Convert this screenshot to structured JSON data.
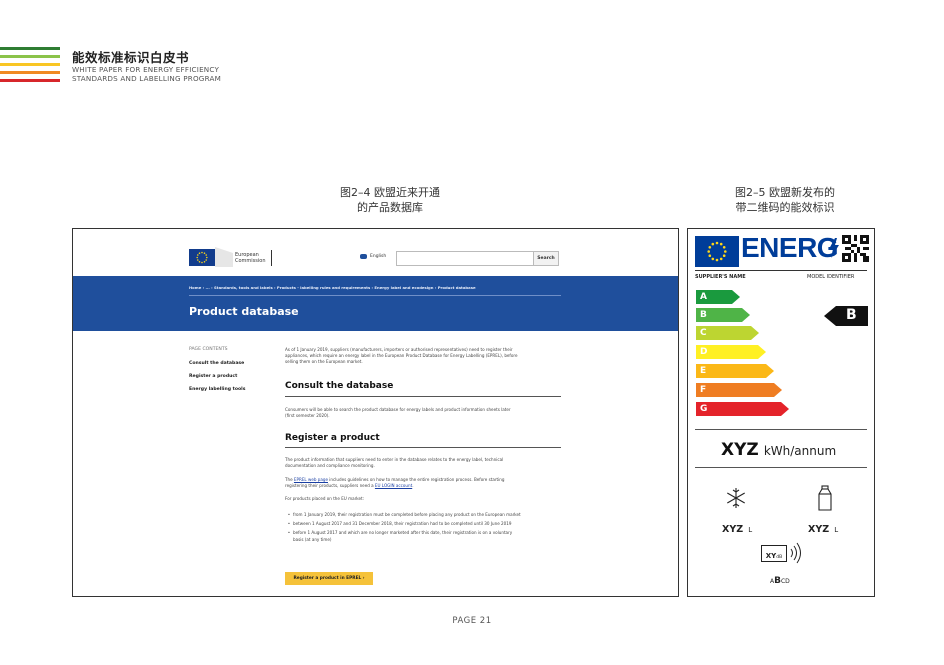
{
  "header": {
    "title_zh": "能效标准标识白皮书",
    "title_en_line1": "WHITE PAPER FOR ENERGY EFFICIENCY",
    "title_en_line2": "STANDARDS AND LABELLING PROGRAM",
    "stripe_colors": [
      "#2e7d32",
      "#8bc34a",
      "#f9c623",
      "#f08a24",
      "#d7262b"
    ]
  },
  "figures": {
    "fig1_caption_line1": "图2–4  欧盟近来开通",
    "fig1_caption_line2": "的产品数据库",
    "fig2_caption_line1": "图2–5  欧盟新发布的",
    "fig2_caption_line2": "带二维码的能效标识"
  },
  "eu_site": {
    "logo_line1": "European",
    "logo_line2": "Commission",
    "language": "English",
    "search_button": "Search",
    "breadcrumb": "Home  ›  ...  ›  Standards, tools and labels  ›  Products - labelling rules and requirements  ›  Energy label and ecodesign  ›  Product database",
    "page_title": "Product database",
    "sidebar": {
      "heading": "PAGE CONTENTS",
      "items": [
        "Consult the database",
        "Register a product",
        "Energy labelling tools"
      ]
    },
    "intro": "As of 1 January 2019, suppliers (manufacturers, importers or authorised representatives) need to register their appliances, which require an energy label in the European Product Database for Energy Labelling (EPREL), before selling them on the European market.",
    "section1_title": "Consult the database",
    "section1_text": "Consumers will be able to search the product database for energy labels and product information sheets later (first semester 2020).",
    "section2_title": "Register a product",
    "section2_p1": "The product information that suppliers need to enter in the database relates to the energy label, technical documentation and compliance monitoring.",
    "section2_p2_pre": "The ",
    "section2_p2_link1": "EPREL web page",
    "section2_p2_mid": " includes guidelines on how to manage the entire registration process. Before starting registering their products, suppliers need a ",
    "section2_p2_link2": "EU LOGIN account",
    "section2_p2_post": ".",
    "section2_p3": "For products placed on the EU market:",
    "bullets": [
      "from 1 January 2019, their registration must be completed before placing any product on the European market",
      "between 1 August 2017 and 31 December 2018, their registration had to be completed until 30 June 2019",
      "before 1 August 2017 and which are no longer marketed after this date, their registration is on a voluntary basis (at any time)"
    ],
    "cta_button": "Register a product in EPREL  ›"
  },
  "energy_label": {
    "brand": "ENERG",
    "supplier": "SUPPLIER'S NAME",
    "model": "MODEL IDENTIFIER",
    "classes": [
      {
        "letter": "A",
        "color": "#1a9a3e"
      },
      {
        "letter": "B",
        "color": "#4fb447"
      },
      {
        "letter": "C",
        "color": "#bdd531"
      },
      {
        "letter": "D",
        "color": "#fff023"
      },
      {
        "letter": "E",
        "color": "#fbb817"
      },
      {
        "letter": "F",
        "color": "#ef7d22"
      },
      {
        "letter": "G",
        "color": "#e4232a"
      }
    ],
    "rating": "B",
    "consumption_value": "XYZ",
    "consumption_unit": "kWh/annum",
    "freezer_value": "XYZ",
    "freezer_unit": "L",
    "fridge_value": "XYZ",
    "fridge_unit": "L",
    "noise_value": "XY",
    "noise_unit": "dB",
    "noise_class_pre": "A",
    "noise_class_active": "B",
    "noise_class_post": "CD"
  },
  "footer": {
    "page": "PAGE 21"
  }
}
